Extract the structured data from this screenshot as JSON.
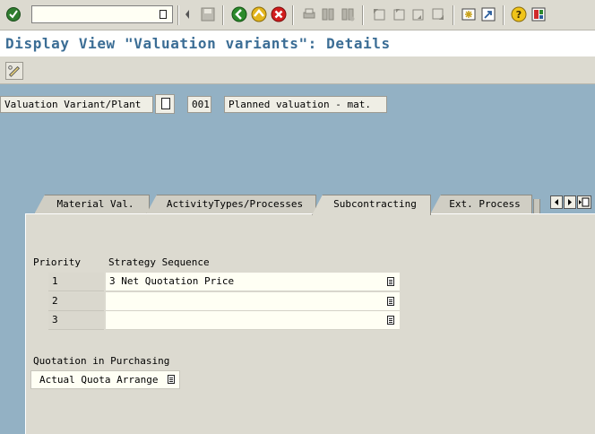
{
  "title": "Display View \"Valuation variants\": Details",
  "header": {
    "field_label": "Valuation Variant/Plant",
    "variant_code": "001",
    "variant_text": "Planned valuation - mat."
  },
  "tabs": [
    {
      "label": "Material Val."
    },
    {
      "label": "ActivityTypes/Processes"
    },
    {
      "label": "Subcontracting"
    },
    {
      "label": "Ext. Process"
    }
  ],
  "subcontracting": {
    "priority_header": "Priority",
    "strategy_header": "Strategy Sequence",
    "rows": [
      {
        "priority": "1",
        "strategy": "3 Net Quotation Price"
      },
      {
        "priority": "2",
        "strategy": ""
      },
      {
        "priority": "3",
        "strategy": ""
      }
    ],
    "quotation_label": "Quotation in Purchasing",
    "quotation_value": "Actual Quota Arrange"
  },
  "colors": {
    "background": "#93b1c4",
    "title": "#3b6d95",
    "panel": "#dcdad0",
    "input": "#fffff4"
  }
}
